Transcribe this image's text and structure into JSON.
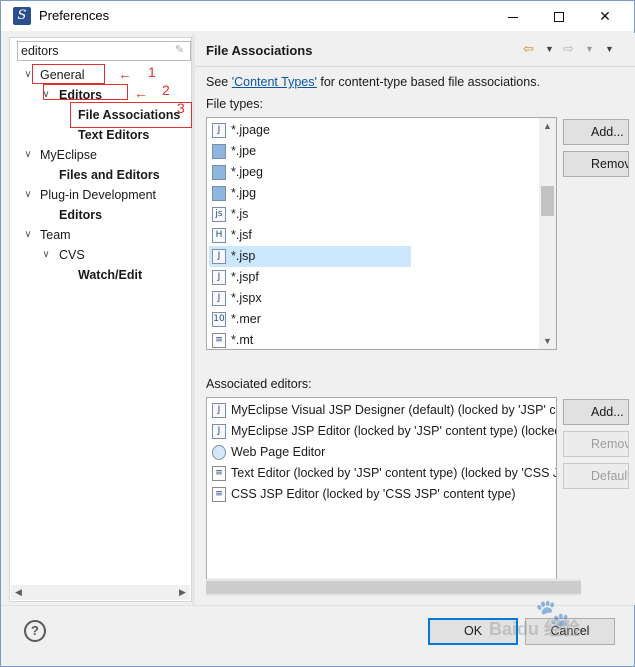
{
  "window": {
    "title": "Preferences",
    "app_icon_letter": "S",
    "minimize_icon": "minimize-icon",
    "maximize_icon": "maximize-icon",
    "close_icon": "close-icon",
    "close_glyph": "✕"
  },
  "filter": {
    "value": "editors",
    "clear_icon": "clear-filter-icon",
    "clear_glyph": "✎"
  },
  "tree": [
    {
      "label": "General",
      "expanded": true,
      "bold": false
    },
    {
      "label": "Editors",
      "expanded": true,
      "bold": true
    },
    {
      "label": "File Associations",
      "bold": true,
      "selected": true
    },
    {
      "label": "Text Editors",
      "bold": true
    },
    {
      "label": "MyEclipse",
      "expanded": true,
      "bold": false
    },
    {
      "label": "Files and Editors",
      "bold": true
    },
    {
      "label": "Plug-in Development",
      "expanded": true,
      "bold": false
    },
    {
      "label": "Editors",
      "bold": true
    },
    {
      "label": "Team",
      "expanded": true,
      "bold": false
    },
    {
      "label": "CVS",
      "expanded": true,
      "bold": false
    },
    {
      "label": "Watch/Edit",
      "bold": true
    }
  ],
  "annotations": {
    "num1": "1",
    "num2": "2",
    "num3": "3",
    "arrow": "←"
  },
  "header": {
    "title": "File Associations",
    "back_glyph": "⇦",
    "forward_glyph": "⇨",
    "dropdown_glyph": "▼"
  },
  "see_text": {
    "prefix": "See ",
    "link": "'Content Types'",
    "suffix": " for content-type based file associations."
  },
  "file_types": {
    "label": "File types:",
    "items": [
      {
        "name": "*.jpage",
        "icon": "j"
      },
      {
        "name": "*.jpe",
        "icon": "img"
      },
      {
        "name": "*.jpeg",
        "icon": "img"
      },
      {
        "name": "*.jpg",
        "icon": "img"
      },
      {
        "name": "*.js",
        "icon": "js"
      },
      {
        "name": "*.jsf",
        "icon": "H"
      },
      {
        "name": "*.jsp",
        "icon": "j",
        "selected": true
      },
      {
        "name": "*.jspf",
        "icon": "j"
      },
      {
        "name": "*.jspx",
        "icon": "j"
      },
      {
        "name": "*.mer",
        "icon": "mer"
      },
      {
        "name": "*.mt",
        "icon": "txt"
      }
    ]
  },
  "file_type_buttons": {
    "add": "Add...",
    "remove": "Remove"
  },
  "associated_editors": {
    "label": "Associated editors:",
    "items": [
      {
        "name": "MyEclipse Visual JSP Designer (default) (locked by 'JSP' content type)",
        "icon": "j"
      },
      {
        "name": "MyEclipse JSP Editor (locked by 'JSP' content type) (locked by 'JSP' content type)",
        "icon": "j"
      },
      {
        "name": "Web Page Editor",
        "icon": "web"
      },
      {
        "name": "Text Editor (locked by 'JSP' content type) (locked by 'CSS JSP' content type)",
        "icon": "txt"
      },
      {
        "name": "CSS JSP Editor (locked by 'CSS JSP' content type)",
        "icon": "txt"
      }
    ]
  },
  "editor_buttons": {
    "add": "Add...",
    "remove": "Remove",
    "default": "Default"
  },
  "footer": {
    "help_glyph": "?",
    "ok": "OK",
    "cancel": "Cancel"
  },
  "watermark": {
    "text": "Baidu 经验",
    "paw": "🐾"
  },
  "scroll_glyphs": {
    "up": "▲",
    "down": "▼",
    "left": "◀",
    "right": "▶"
  }
}
